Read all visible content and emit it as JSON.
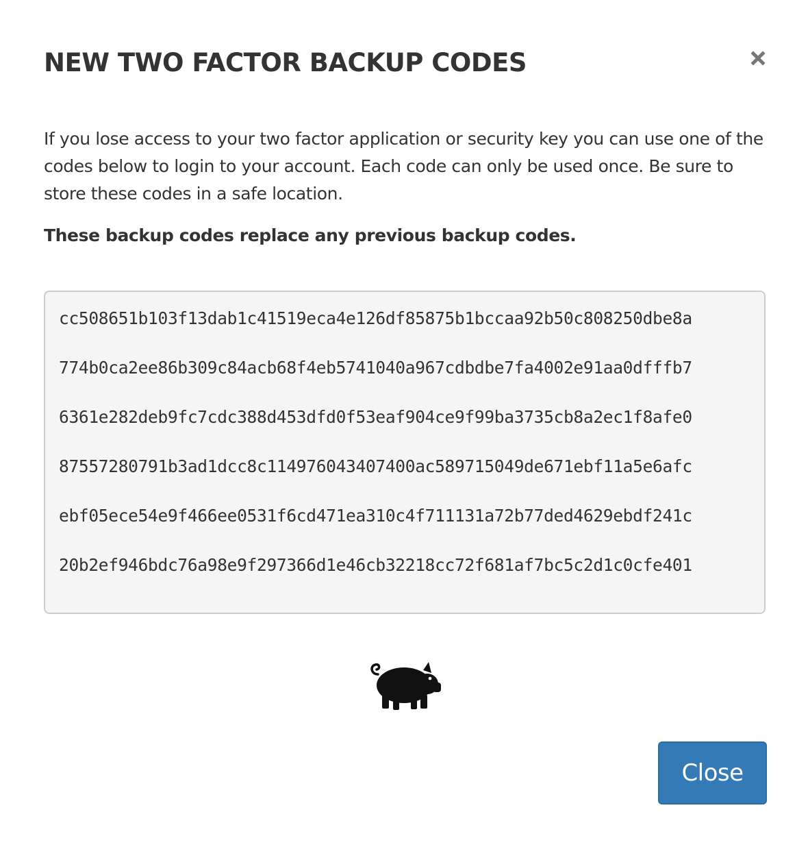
{
  "modal": {
    "title": "NEW TWO FACTOR BACKUP CODES",
    "close_icon": "close-icon",
    "description": "If you lose access to your two factor application or security key you can use one of the codes below to login to your account. Each code can only be used once. Be sure to store these codes in a safe location.",
    "warning": "These backup codes replace any previous backup codes.",
    "codes": [
      "cc508651b103f13dab1c41519eca4e126df85875b1bccaa92b50c808250dbe8a",
      "774b0ca2ee86b309c84acb68f4eb5741040a967cdbdbe7fa4002e91aa0dfffb7",
      "6361e282deb9fc7cdc388d453dfd0f53eaf904ce9f99ba3735cb8a2ec1f8afe0",
      "87557280791b3ad1dcc8c114976043407400ac589715049de671ebf11a5e6afc",
      "ebf05ece54e9f466ee0531f6cd471ea310c4f711131a72b77ded4629ebdf241c",
      "20b2ef946bdc76a98e9f297366d1e46cb32218cc72f681af7bc5c2d1c0cfe401"
    ],
    "mascot_icon": "pig-icon",
    "close_button_label": "Close"
  },
  "colors": {
    "text": "#333333",
    "code_box_bg": "#f5f5f5",
    "code_box_border": "#cccccc",
    "primary_button": "#337ab7",
    "close_icon": "#777777"
  }
}
